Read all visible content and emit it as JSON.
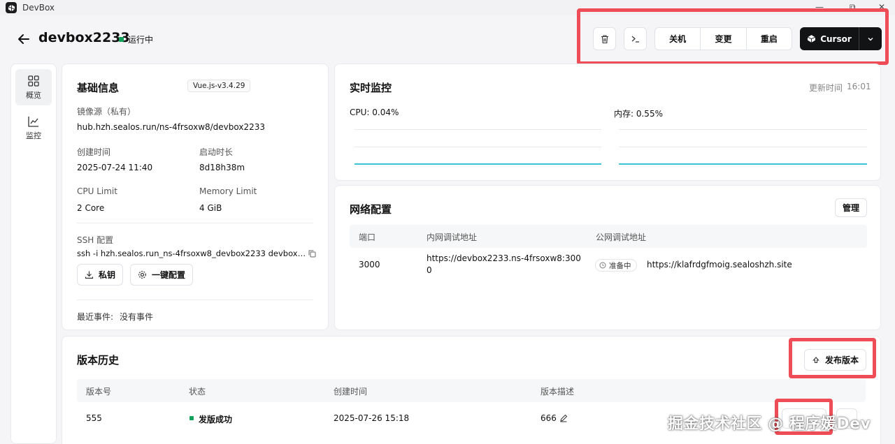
{
  "window": {
    "app_title": "DevBox",
    "minimize": "—",
    "maximize": "⧉",
    "close": "✕"
  },
  "header": {
    "name": "devbox2233",
    "status": "运行中",
    "actions": {
      "shutdown": "关机",
      "change": "变更",
      "restart": "重启"
    },
    "ide": "Cursor"
  },
  "sidebar": {
    "items": [
      {
        "label": "概览"
      },
      {
        "label": "监控"
      }
    ]
  },
  "basic": {
    "title": "基础信息",
    "runtime_tag": "Vue.js-v3.4.29",
    "image_label": "镜像源（私有）",
    "image_value": "hub.hzh.sealos.run/ns-4frsoxw8/devbox2233",
    "created_label": "创建时间",
    "created_value": "2025-07-24 11:40",
    "uptime_label": "启动时长",
    "uptime_value": "8d18h38m",
    "cpu_label": "CPU Limit",
    "cpu_value": "2 Core",
    "mem_label": "Memory Limit",
    "mem_value": "4 GiB",
    "ssh_label": "SSH 配置",
    "ssh_value": "ssh -i hzh.sealos.run_ns-4frsoxw8_devbox2233 devbox…",
    "private_key_btn": "私钥",
    "one_click_btn": "一键配置",
    "events_label": "最近事件:",
    "events_value": "没有事件"
  },
  "monitor": {
    "title": "实时监控",
    "update_label": "更新时间",
    "update_time": "16:01",
    "cpu": "CPU: 0.04%",
    "mem": "内存: 0.55%",
    "cpu_percent": 0.04,
    "mem_percent": 0.55,
    "line_color": "#39c3d4"
  },
  "network": {
    "title": "网络配置",
    "manage_btn": "管理",
    "columns": [
      "端口",
      "内网调试地址",
      "公网调试地址"
    ],
    "rows": [
      {
        "port": "3000",
        "internal_1": "https://devbox2233.ns-4frsoxw8:300",
        "internal_2": "0",
        "public_status": "准备中",
        "public_url": "https://klafrdgfmoig.sealoshzh.site"
      }
    ]
  },
  "versions": {
    "title": "版本历史",
    "publish_btn": "发布版本",
    "columns": [
      "版本号",
      "状态",
      "创建时间",
      "版本描述"
    ],
    "rows": [
      {
        "version": "555",
        "status": "发版成功",
        "created": "2025-07-26 15:18",
        "description": "666"
      }
    ]
  },
  "watermark": "掘金技术社区 @ 程序媛Dev",
  "colors": {
    "annotation": "#ee4d57",
    "running": "#12a15b",
    "accent_dark": "#111315"
  }
}
